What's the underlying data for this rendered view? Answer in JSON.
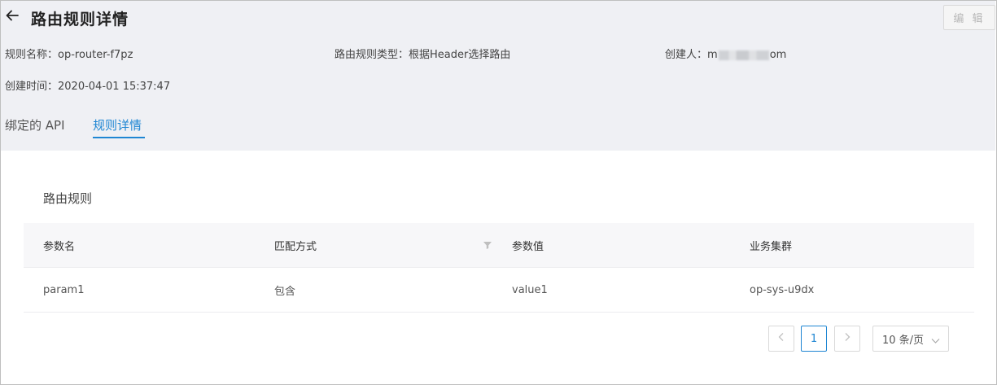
{
  "header": {
    "title": "路由规则详情",
    "edit_label": "编 辑"
  },
  "meta": {
    "rule_name_label": "规则名称：",
    "rule_name_value": "op-router-f7pz",
    "rule_type_label": "路由规则类型：",
    "rule_type_value": "根据Header选择路由",
    "creator_label": "创建人：",
    "creator_prefix": "m",
    "creator_suffix": "om",
    "created_time_label": "创建时间：",
    "created_time_value": "2020-04-01 15:37:47"
  },
  "tabs": [
    {
      "label": "绑定的 API"
    },
    {
      "label": "规则详情"
    }
  ],
  "section": {
    "title": "路由规则"
  },
  "table": {
    "columns": [
      "参数名",
      "匹配方式",
      "参数值",
      "业务集群"
    ],
    "rows": [
      [
        "param1",
        "包含",
        "value1",
        "op-sys-u9dx"
      ]
    ]
  },
  "pagination": {
    "current_page": "1",
    "page_size": "10 条/页"
  },
  "icons": {
    "back": "arrow-left-icon",
    "filter": "filter-icon",
    "prev": "chevron-left-icon",
    "next": "chevron-right-icon",
    "dropdown": "chevron-down-icon"
  },
  "colors": {
    "accent": "#1f86d3",
    "header_bg": "#eff0f4"
  }
}
